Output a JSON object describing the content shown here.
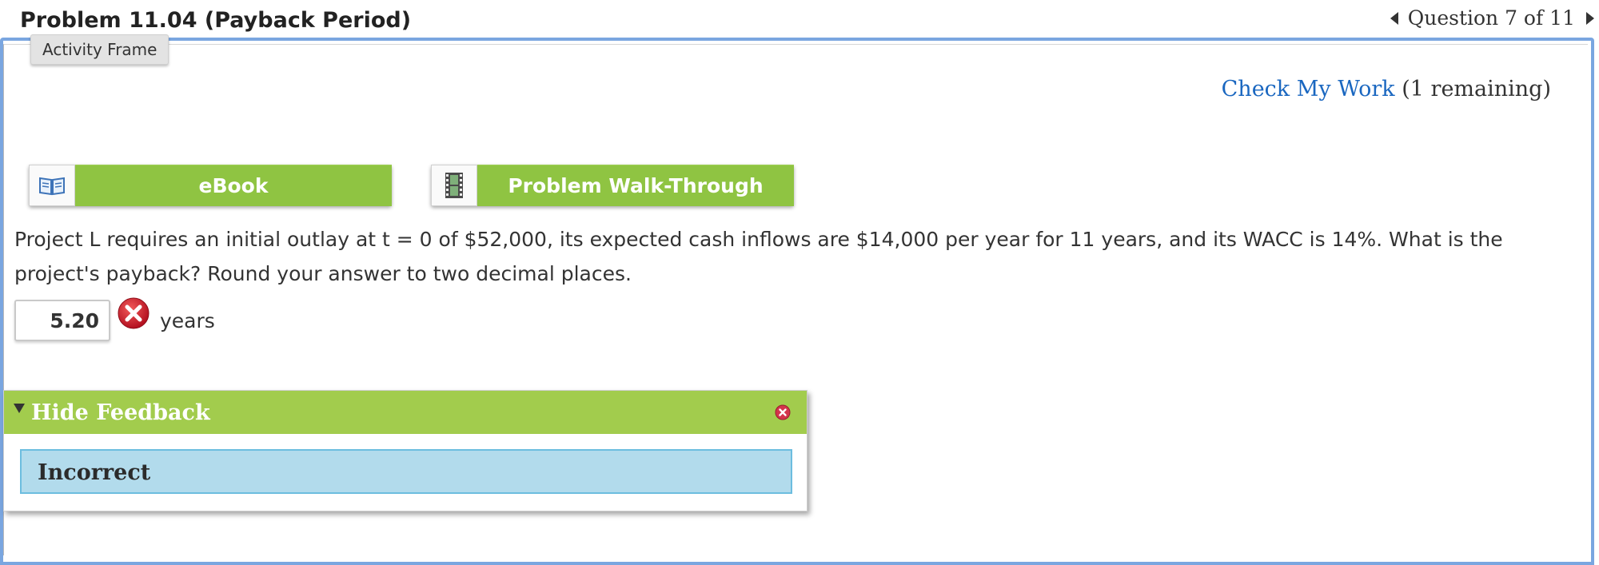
{
  "header": {
    "problem_title": "Problem 11.04 (Payback Period)",
    "question_nav": "Question 7 of 11"
  },
  "frame": {
    "tooltip": "Activity Frame"
  },
  "check_work": {
    "link_label": "Check My Work",
    "remaining": "(1 remaining)"
  },
  "resources": {
    "ebook_label": "eBook",
    "ebook_icon": "book-icon",
    "walkthrough_label": "Problem Walk-Through",
    "walkthrough_icon": "film-icon"
  },
  "question": {
    "text": "Project L requires an initial outlay at t = 0 of $52,000, its expected cash inflows are $14,000 per year for 11 years, and its WACC is 14%. What is the project's payback? Round your answer to two decimal places.",
    "answer_value": "5.20",
    "answer_status_icon": "incorrect-x-icon",
    "units": "years"
  },
  "feedback": {
    "toggle_label": "Hide Feedback",
    "status": "Incorrect"
  },
  "colors": {
    "frame_border": "#7aa6e0",
    "button_green": "#8fc442",
    "feedback_green": "#a2cc4d",
    "feedback_blue": "#b2dbec",
    "link_blue": "#1a67c0",
    "error_red": "#c8102e"
  }
}
